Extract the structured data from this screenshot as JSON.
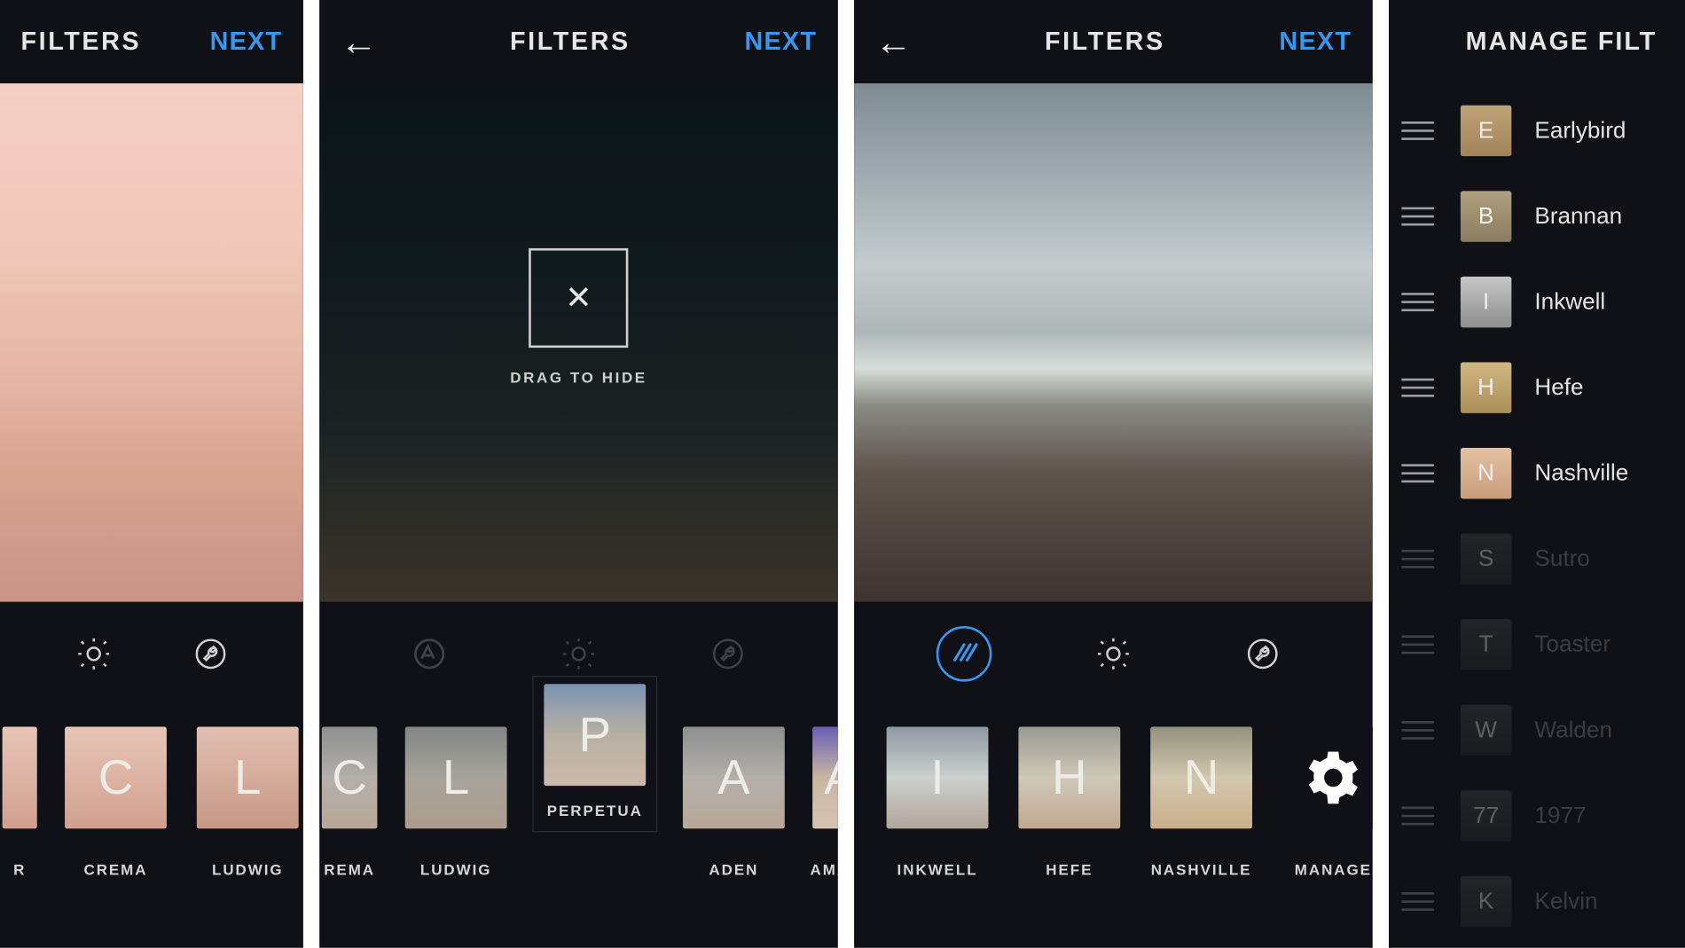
{
  "screen1": {
    "title": "FILTERS",
    "next": "NEXT",
    "filters": [
      {
        "letter": "",
        "label": "R"
      },
      {
        "letter": "C",
        "label": "CREMA"
      },
      {
        "letter": "L",
        "label": "LUDWIG"
      }
    ]
  },
  "screen2": {
    "title": "FILTERS",
    "next": "NEXT",
    "drop_label": "DRAG TO HIDE",
    "drop_icon": "✕",
    "filters": [
      {
        "letter": "C",
        "label": "REMA"
      },
      {
        "letter": "L",
        "label": "LUDWIG"
      },
      {
        "letter": "P",
        "label": "PERPETUA",
        "lifted": true
      },
      {
        "letter": "A",
        "label": "ADEN"
      },
      {
        "letter": "A",
        "label": "AMAR"
      }
    ]
  },
  "screen3": {
    "title": "FILTERS",
    "next": "NEXT",
    "filters": [
      {
        "letter": "I",
        "label": "INKWELL"
      },
      {
        "letter": "H",
        "label": "HEFE"
      },
      {
        "letter": "N",
        "label": "NASHVILLE"
      },
      {
        "letter": "",
        "label": "MANAGE",
        "gear": true
      }
    ]
  },
  "screen4": {
    "title": "MANAGE FILT",
    "items": [
      {
        "letter": "E",
        "label": "Earlybird",
        "disabled": false
      },
      {
        "letter": "B",
        "label": "Brannan",
        "disabled": false
      },
      {
        "letter": "I",
        "label": "Inkwell",
        "disabled": false
      },
      {
        "letter": "H",
        "label": "Hefe",
        "disabled": false
      },
      {
        "letter": "N",
        "label": "Nashville",
        "disabled": false
      },
      {
        "letter": "S",
        "label": "Sutro",
        "disabled": true
      },
      {
        "letter": "T",
        "label": "Toaster",
        "disabled": true
      },
      {
        "letter": "W",
        "label": "Walden",
        "disabled": true
      },
      {
        "letter": "77",
        "label": "1977",
        "disabled": true
      },
      {
        "letter": "K",
        "label": "Kelvin",
        "disabled": true
      }
    ]
  }
}
